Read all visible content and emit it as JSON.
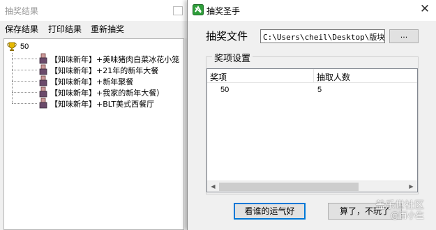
{
  "left_window": {
    "title": "抽奖结果",
    "menu": [
      "保存结果",
      "打印结果",
      "重新抽奖"
    ],
    "tree": {
      "root": "50",
      "root_icon": "trophy-icon",
      "item_icon": "person-icon",
      "items": [
        "【知味新年】+美味猪肉白菜冰花小笼",
        "【知味新年】+21年的新年大餐",
        "【知味新年】+新年聚餐",
        "【知味新年】+我家的新年大餐）",
        "【知味新年】+BLT美式西餐厅"
      ]
    }
  },
  "dialog": {
    "title": "抽奖圣手",
    "app_icon": "app-logo-icon",
    "close_icon": "close-icon",
    "file_label": "抽奖文件",
    "file_path": "C:\\Users\\cheil\\Desktop\\版块活",
    "browse_label": "...",
    "group_label": "奖项设置",
    "columns": [
      "奖项",
      "抽取人数"
    ],
    "rows": [
      {
        "prize": "50",
        "count": "5"
      }
    ],
    "lucky_button": "看谁的运气好",
    "quit_button": "算了，不玩了"
  },
  "watermark": {
    "line1": "盖乐世社区",
    "line2": "@百小生"
  },
  "colors": {
    "window_bg": "#f0f0f0",
    "focus_blue": "#0078d7",
    "logo_green": "#2e9e3a"
  }
}
